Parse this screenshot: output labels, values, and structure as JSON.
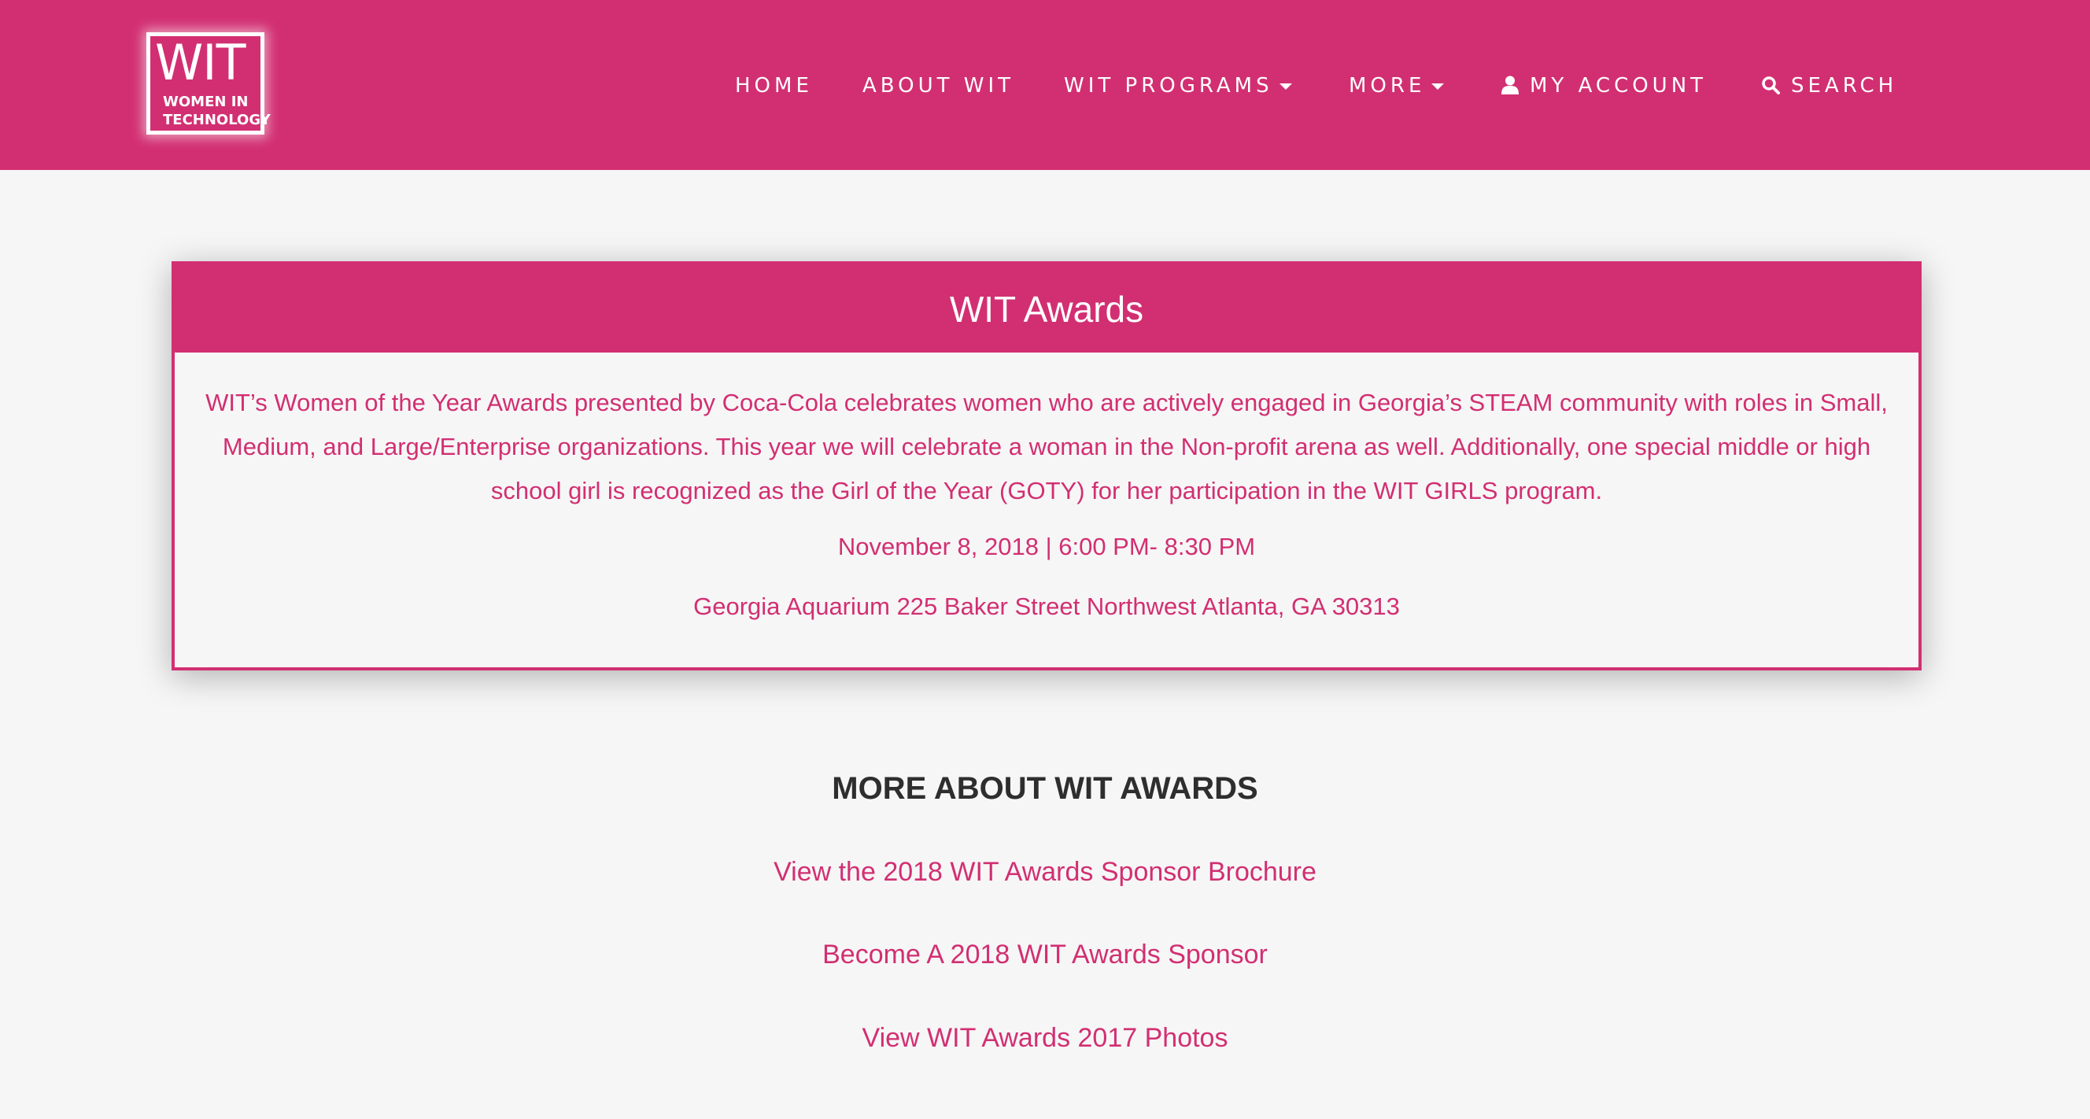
{
  "header": {
    "logo": {
      "main": "WIT",
      "line1": "WOMEN IN",
      "line2": "TECHNOLOGY"
    },
    "nav": [
      {
        "label": "HOME",
        "icon": null,
        "dropdown": false
      },
      {
        "label": "ABOUT WIT",
        "icon": null,
        "dropdown": false
      },
      {
        "label": "WIT PROGRAMS",
        "icon": "chevron-down-icon",
        "dropdown": true
      },
      {
        "label": "MORE",
        "icon": "chevron-down-icon",
        "dropdown": true
      },
      {
        "label": "MY ACCOUNT",
        "icon": "user-icon",
        "dropdown": false
      },
      {
        "label": "SEARCH",
        "icon": "search-icon",
        "dropdown": false
      }
    ]
  },
  "awards_card": {
    "title": "WIT Awards",
    "description": "WIT’s Women of the Year Awards presented by Coca-Cola celebrates women who are actively engaged in Georgia’s STEAM community with roles in Small, Medium, and Large/Enterprise organizations. This year we will celebrate a woman in the Non-profit arena as well. Additionally, one special middle or high school girl is recognized as the Girl of the Year (GOTY) for her participation in the WIT GIRLS program.",
    "date_time": "November 8, 2018 | 6:00 PM- 8:30 PM",
    "location": "Georgia Aquarium 225 Baker Street Northwest Atlanta, GA 30313"
  },
  "more_section": {
    "title": "MORE ABOUT WIT AWARDS",
    "links": [
      "View the 2018 WIT Awards Sponsor Brochure",
      "Become A 2018 WIT Awards Sponsor",
      "View WIT Awards 2017 Photos"
    ]
  },
  "colors": {
    "brand_pink": "#d22f72",
    "background": "#f6f6f6",
    "heading_dark": "#2e2e2e"
  }
}
